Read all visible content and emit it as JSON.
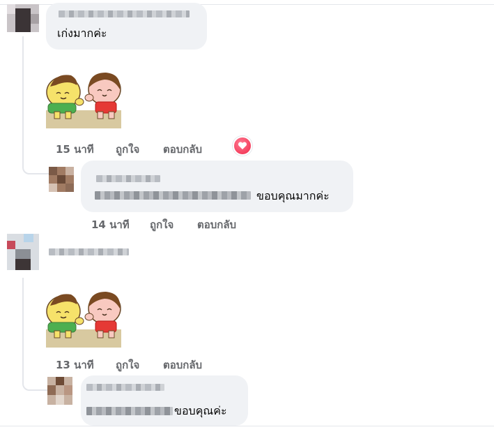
{
  "comments": [
    {
      "message": "เก่งมากค่ะ",
      "sticker": "sticker-friends-waving",
      "time": "15 นาที",
      "like_label": "ถูกใจ",
      "reply_label": "ตอบกลับ",
      "reaction": "heart-icon",
      "reply": {
        "message": "ขอบคุณมากค่ะ",
        "time": "14 นาที",
        "like_label": "ถูกใจ",
        "reply_label": "ตอบกลับ"
      }
    },
    {
      "sticker": "sticker-friends-waving",
      "time": "13 นาที",
      "like_label": "ถูกใจ",
      "reply_label": "ตอบกลับ",
      "reply": {
        "message": "ขอบคุณค่ะ"
      }
    }
  ],
  "colors": {
    "bubble": "#f0f2f5",
    "action_text": "#65676b",
    "heart": "#f02849"
  }
}
